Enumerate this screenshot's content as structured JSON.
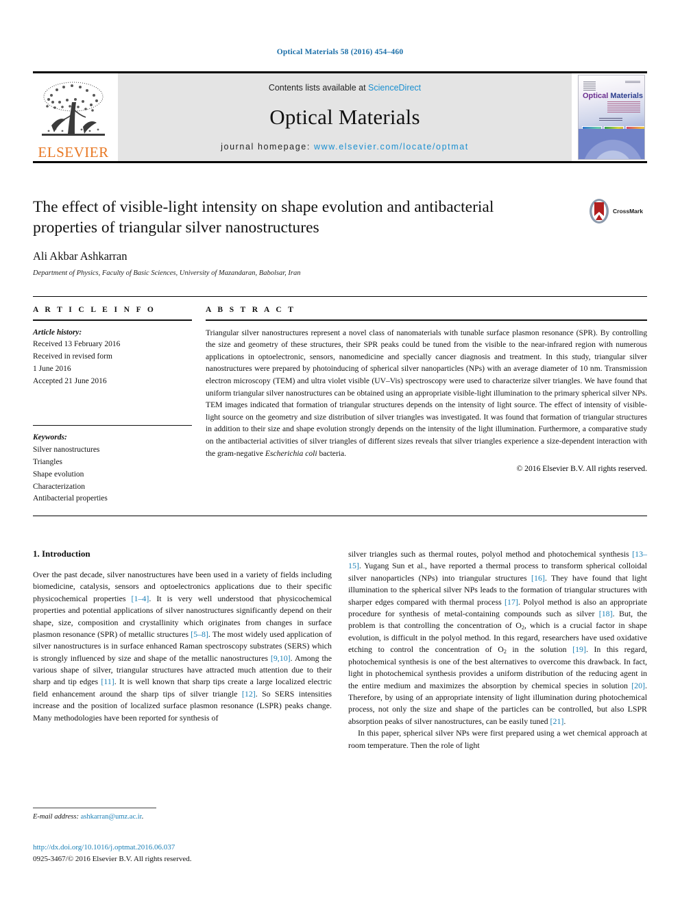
{
  "running_head": "Optical Materials 58 (2016) 454–460",
  "masthead": {
    "publisher_wordmark": "ELSEVIER",
    "contents_prefix": "Contents lists available at",
    "contents_link": "ScienceDirect",
    "journal_title": "Optical Materials",
    "homepage_prefix": "journal homepage:",
    "homepage_url": "www.elsevier.com/locate/optmat",
    "cover_title_part1": "Optical",
    "cover_title_part2": "Materials",
    "link_color": "#1a8fd0"
  },
  "article": {
    "title": "The effect of visible-light intensity on shape evolution and antibacterial properties of triangular silver nanostructures",
    "author": "Ali Akbar Ashkarran",
    "affiliation": "Department of Physics, Faculty of Basic Sciences, University of Mazandaran, Babolsar, Iran",
    "crossmark_label": "CrossMark"
  },
  "info": {
    "heading": "A R T I C L E   I N F O",
    "history_label": "Article history:",
    "history": [
      "Received 13 February 2016",
      "Received in revised form",
      "1 June 2016",
      "Accepted 21 June 2016"
    ],
    "keywords_label": "Keywords:",
    "keywords": [
      "Silver nanostructures",
      "Triangles",
      "Shape evolution",
      "Characterization",
      "Antibacterial properties"
    ]
  },
  "abstract": {
    "heading": "A B S T R A C T",
    "text_part1": "Triangular silver nanostructures represent a novel class of nanomaterials with tunable surface plasmon resonance (SPR). By controlling the size and geometry of these structures, their SPR peaks could be tuned from the visible to the near-infrared region with numerous applications in optoelectronic, sensors, nanomedicine and specially cancer diagnosis and treatment. In this study, triangular silver nanostructures were prepared by photoinducing of spherical silver nanoparticles (NPs) with an average diameter of 10 nm. Transmission electron microscopy (TEM) and ultra violet visible (UV–Vis) spectroscopy were used to characterize silver triangles. We have found that uniform triangular silver nanostructures can be obtained using an appropriate visible-light illumination to the primary spherical silver NPs. TEM images indicated that formation of triangular structures depends on the intensity of light source. The effect of intensity of visible-light source on the geometry and size distribution of silver triangles was investigated. It was found that formation of triangular structures in addition to their size and shape evolution strongly depends on the intensity of the light illumination. Furthermore, a comparative study on the antibacterial activities of silver triangles of different sizes reveals that silver triangles experience a size-dependent interaction with the gram-negative ",
    "text_italic": "Escherichia coli",
    "text_part2": " bacteria.",
    "copyright": "© 2016 Elsevier B.V. All rights reserved."
  },
  "body": {
    "section_number_title": "1. Introduction",
    "left_col": {
      "p1_a": "Over the past decade, silver nanostructures have been used in a variety of fields including biomedicine, catalysis, sensors and optoelectronics applications due to their specific physicochemical properties ",
      "ref1": "[1–4]",
      "p1_b": ". It is very well understood that physicochemical properties and potential applications of silver nanostructures significantly depend on their shape, size, composition and crystallinity which originates from changes in surface plasmon resonance (SPR) of metallic structures ",
      "ref2": "[5–8]",
      "p1_c": ". The most widely used application of silver nanostructures is in surface enhanced Raman spectroscopy substrates (SERS) which is strongly influenced by size and shape of the metallic nanostructures ",
      "ref3": "[9,10]",
      "p1_d": ". Among the various shape of silver, triangular structures have attracted much attention due to their sharp and tip edges ",
      "ref4": "[11]",
      "p1_e": ". It is well known that sharp tips create a large localized electric field enhancement around the sharp tips of silver triangle ",
      "ref5": "[12]",
      "p1_f": ". So SERS intensities increase and the position of localized surface plasmon resonance (LSPR) peaks change. Many methodologies have been reported for synthesis of"
    },
    "right_col": {
      "p1_a": "silver triangles such as thermal routes, polyol method and photochemical synthesis ",
      "ref1": "[13–15]",
      "p1_b": ". Yugang Sun et al., have reported a thermal process to transform spherical colloidal silver nanoparticles (NPs) into triangular structures ",
      "ref2": "[16]",
      "p1_c": ". They have found that light illumination to the spherical silver NPs leads to the formation of triangular structures with sharper edges compared with thermal process ",
      "ref3": "[17]",
      "p1_d": ". Polyol method is also an appropriate procedure for synthesis of metal-containing compounds such as silver ",
      "ref4": "[18]",
      "p1_e": ". But, the problem is that controlling the concentration of O",
      "sub1": "2",
      "p1_f": ", which is a crucial factor in shape evolution, is difficult in the polyol method. In this regard, researchers have used oxidative etching to control the concentration of O",
      "sub2": "2",
      "p1_g": " in the solution ",
      "ref5": "[19]",
      "p1_h": ". In this regard, photochemical synthesis is one of the best alternatives to overcome this drawback. In fact, light in photochemical synthesis provides a uniform distribution of the reducing agent in the entire medium and maximizes the absorption by chemical species in solution ",
      "ref6": "[20]",
      "p1_i": ". Therefore, by using of an appropriate intensity of light illumination during photochemical process, not only the size and shape of the particles can be controlled, but also LSPR absorption peaks of silver nanostructures, can be easily tuned ",
      "ref7": "[21]",
      "p1_j": ".",
      "p2": "In this paper, spherical silver NPs were first prepared using a wet chemical approach at room temperature. Then the role of light"
    }
  },
  "footer": {
    "email_label": "E-mail address:",
    "email": "ashkarran@umz.ac.ir",
    "email_tail": ".",
    "doi": "http://dx.doi.org/10.1016/j.optmat.2016.06.037",
    "issn_line": "0925-3467/© 2016 Elsevier B.V. All rights reserved."
  }
}
